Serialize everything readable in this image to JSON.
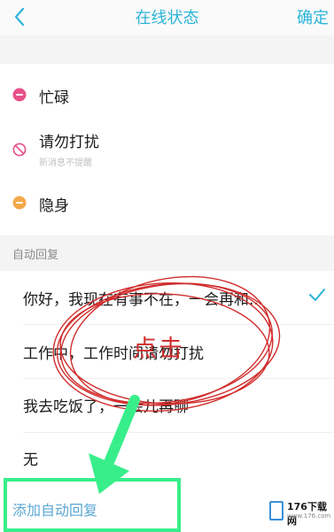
{
  "header": {
    "title": "在线状态",
    "confirm_label": "确定"
  },
  "statuses": [
    {
      "label": "忙碌",
      "color": "#e8508a"
    },
    {
      "label": "请勿打扰",
      "sublabel": "新消息不提醒",
      "color": "#e8508a"
    },
    {
      "label": "隐身",
      "color": "#f4a84a"
    }
  ],
  "auto_reply": {
    "section_label": "自动回复",
    "items": [
      {
        "text": "你好，我现在有事不在，一会再和...",
        "selected": true
      },
      {
        "text": "工作中，工作时间请勿打扰",
        "selected": false
      },
      {
        "text": "我去吃饭了，一会儿再聊",
        "selected": false
      },
      {
        "text": "无",
        "selected": false
      }
    ],
    "add_label": "添加自动回复"
  },
  "annotation": {
    "click_label": "点击"
  },
  "watermark": {
    "name": "176下载网",
    "domain": "www.176.com"
  },
  "colors": {
    "accent": "#2cb4d8",
    "highlight": "#38ee8a",
    "circle": "#d12e2e"
  }
}
